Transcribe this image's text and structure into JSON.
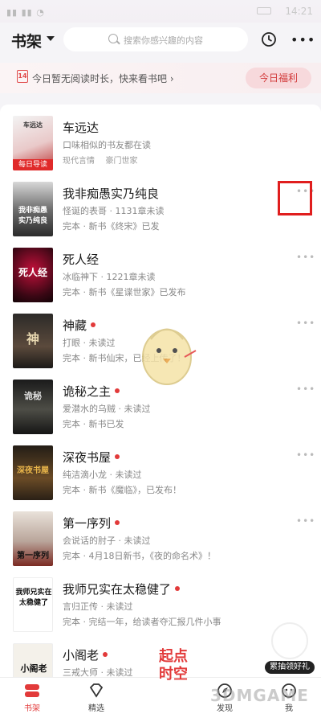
{
  "status_bar": {
    "time": "14:21"
  },
  "header": {
    "title": "书架",
    "search_placeholder": "搜索你感兴趣的内容"
  },
  "banner": {
    "calendar_day": "14",
    "message": "今日暂无阅读时长，快来看书吧 ›",
    "welfare_button": "今日福利"
  },
  "books": [
    {
      "title": "车远达",
      "line1": "口味相似的书友都在读",
      "tags": [
        "现代言情",
        "豪门世家"
      ],
      "cover_tag": "每日导读",
      "cover_text": "车远达",
      "unread_dot": false
    },
    {
      "title": "我非痴愚实乃纯良",
      "line1": "怪诞的表哥 · 1131章未读",
      "line2": "完本 · 新书《终宋》已发",
      "cover_text": "我非痴愚\n实乃纯良",
      "unread_dot": false
    },
    {
      "title": "死人经",
      "line1": "冰临神下 · 1221章未读",
      "line2": "完本 · 新书《星谍世家》已发布",
      "cover_text": "死人经",
      "unread_dot": false
    },
    {
      "title": "神藏",
      "line1": "打眼 · 未读过",
      "line2": "完本 · 新书仙宋，已经上传了！",
      "cover_text": "神",
      "unread_dot": true
    },
    {
      "title": "诡秘之主",
      "line1": "爱潜水的乌贼 · 未读过",
      "line2": "完本 · 新书已发",
      "cover_text": "诡秘",
      "unread_dot": true
    },
    {
      "title": "深夜书屋",
      "line1": "纯洁滴小龙 · 未读过",
      "line2": "完本 · 新书《魔临》，已发布！",
      "cover_text": "深夜书屋",
      "unread_dot": true
    },
    {
      "title": "第一序列",
      "line1": "会说话的肘子 · 未读过",
      "line2": "完本 · 4月18日新书，《夜的命名术》！",
      "cover_text": "第一序列",
      "unread_dot": true
    },
    {
      "title": "我师兄实在太稳健了",
      "line1": "言归正传 · 未读过",
      "line2": "完本 · 完结一年，给读者夺汇报几件小事",
      "cover_text": "我师兄实在\n太稳健了",
      "unread_dot": true
    },
    {
      "title": "小阁老",
      "line1": "三戒大师 · 未读过",
      "line2": "",
      "cover_text": "小阁老",
      "unread_dot": true
    }
  ],
  "promo": {
    "label": "累抽领好礼"
  },
  "overlay": {
    "qidian": "起点\n时空",
    "watermark": "3DMGAME"
  },
  "nav": [
    {
      "label": "书架",
      "active": true
    },
    {
      "label": "精选",
      "active": false
    },
    {
      "label": "",
      "active": false
    },
    {
      "label": "发现",
      "active": false
    },
    {
      "label": "我",
      "active": false
    }
  ],
  "colors": {
    "accent": "#e23a3a",
    "highlight_box": "#e01e1e"
  }
}
